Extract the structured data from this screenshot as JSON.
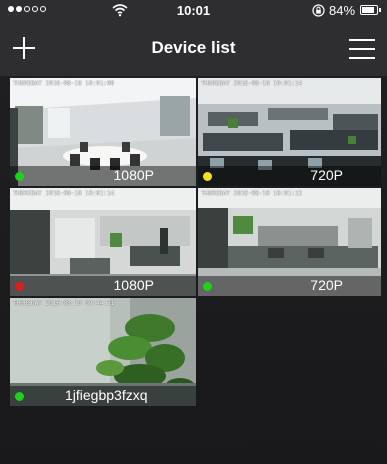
{
  "status_bar": {
    "time": "10:01",
    "battery_pct": "84%",
    "battery_level": 0.84,
    "signal_bars": 2
  },
  "nav": {
    "title": "Device list",
    "add_icon": "plus-icon",
    "menu_icon": "hamburger-menu-icon"
  },
  "devices": [
    {
      "label": "1080P",
      "timestamp": "THURSDAY 2016-08-18 10:01:08",
      "status": "green",
      "status_color": "#19d419"
    },
    {
      "label": "720P",
      "timestamp": "THURSDAY 2016-08-18 10:01:14",
      "status": "yellow",
      "status_color": "#f2e21a"
    },
    {
      "label": "1080P",
      "timestamp": "THURSDAY 2016-08-18 10:01:14",
      "status": "red",
      "status_color": "#e21b1b"
    },
    {
      "label": "720P",
      "timestamp": "THURSDAY 2016-08-18 10:01:12",
      "status": "green",
      "status_color": "#19d419"
    },
    {
      "label": "1jfiegbp3fzxq",
      "timestamp": "THURSDAY 2016-08-18 09:44:31",
      "status": "green",
      "status_color": "#19d419"
    }
  ]
}
